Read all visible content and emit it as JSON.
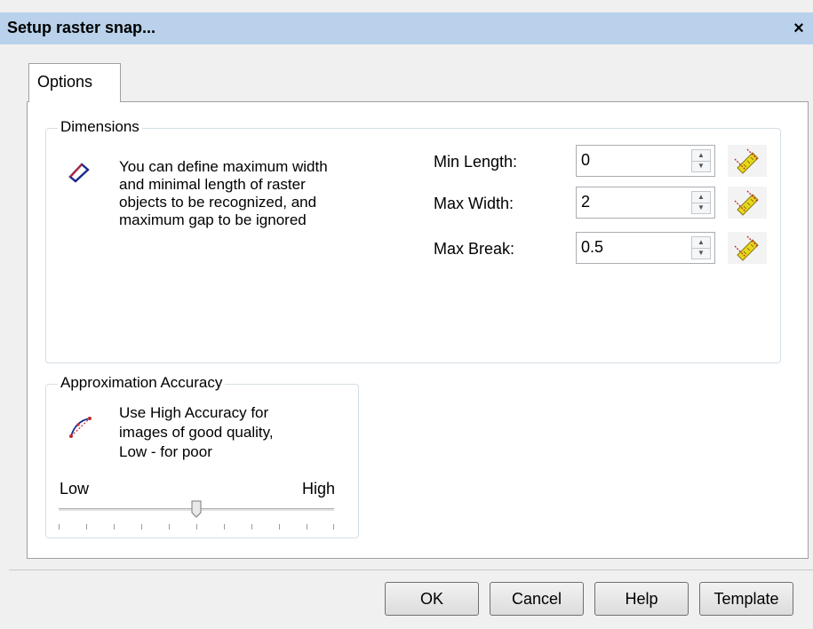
{
  "window": {
    "title": "Setup raster snap...",
    "close_glyph": "×"
  },
  "tabs": [
    {
      "label": "Options",
      "active": true
    }
  ],
  "dimensions": {
    "legend": "Dimensions",
    "icon": "rectangle-line-icon",
    "description_lines": [
      "You can define maximum width",
      "and minimal length of raster",
      "objects to be recognized, and",
      "maximum gap to be ignored"
    ],
    "fields": [
      {
        "label": "Min Length:",
        "value": "0",
        "pick_icon": "ruler-pick-icon"
      },
      {
        "label": "Max Width:",
        "value": "2",
        "pick_icon": "ruler-pick-icon"
      },
      {
        "label": "Max Break:",
        "value": "0.5",
        "pick_icon": "ruler-pick-icon"
      }
    ]
  },
  "accuracy": {
    "legend": "Approximation Accuracy",
    "icon": "curve-points-icon",
    "description_lines": [
      "Use High Accuracy  for",
      "images of good quality,",
      "Low - for poor"
    ],
    "low_label": "Low",
    "high_label": "High",
    "slider_fraction": 0.5
  },
  "buttons": {
    "ok": "OK",
    "cancel": "Cancel",
    "help": "Help",
    "template": "Template"
  },
  "colors": {
    "titlebar": "#b9d1ea",
    "dialog_bg": "#f0f0f0",
    "icon_blue": "#1a2a8c",
    "icon_red": "#c0282c",
    "ruler_yellow": "#e8d81c"
  }
}
